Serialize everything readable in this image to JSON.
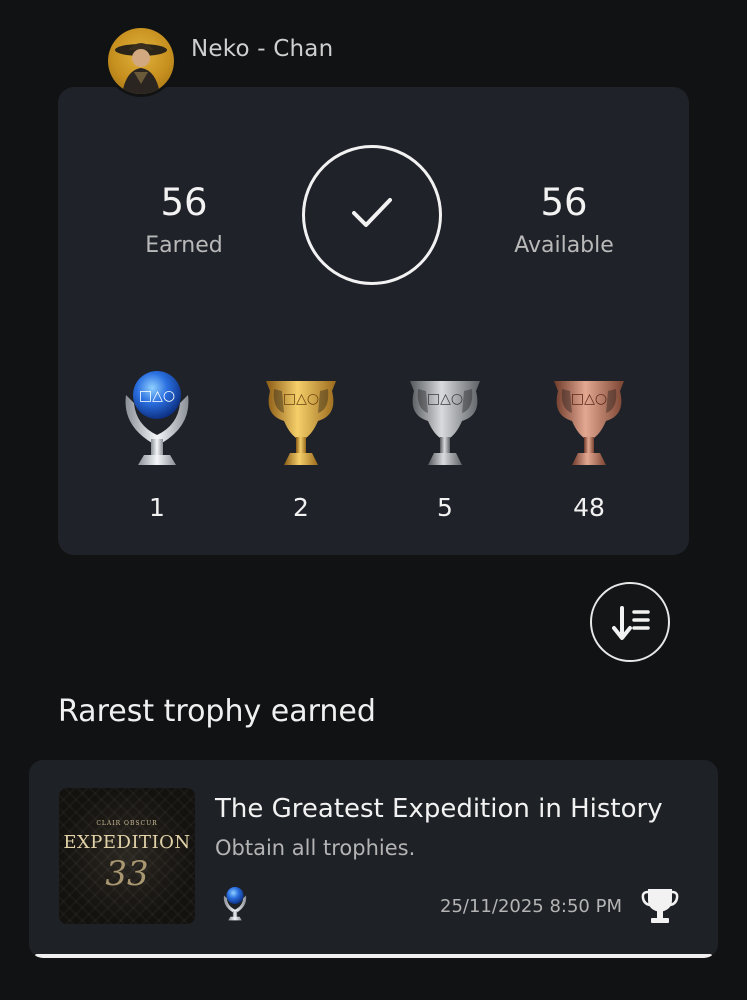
{
  "profile": {
    "username": "Neko - Chan"
  },
  "summary": {
    "earned": {
      "value": "56",
      "label": "Earned"
    },
    "available": {
      "value": "56",
      "label": "Available"
    },
    "status_icon": "check-icon",
    "trophies": [
      {
        "type": "platinum",
        "count": "1",
        "color": "#3d7fd6"
      },
      {
        "type": "gold",
        "count": "2",
        "color": "#d9a33a"
      },
      {
        "type": "silver",
        "count": "5",
        "color": "#b8b8b8"
      },
      {
        "type": "bronze",
        "count": "48",
        "color": "#c0806a"
      }
    ]
  },
  "sort_button": {
    "icon": "sort-icon"
  },
  "rarest": {
    "section_title": "Rarest trophy earned",
    "game_art": {
      "top_text": "CLAIR OBSCUR",
      "main_text": "EXPEDITION",
      "number_text": "33"
    },
    "trophy_name": "The Greatest Expedition in History",
    "trophy_description": "Obtain all trophies.",
    "trophy_type_icon": "platinum-trophy-icon",
    "earned_at": "25/11/2025  8:50 PM",
    "action_icon": "trophy-cup-icon"
  }
}
